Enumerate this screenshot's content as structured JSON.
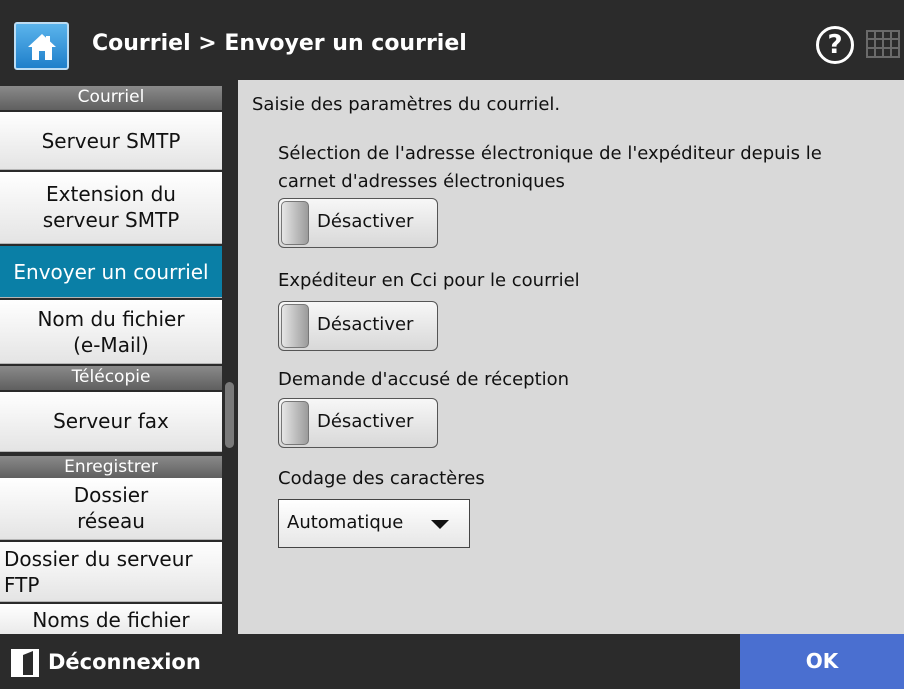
{
  "header": {
    "title": "Courriel > Envoyer un courriel",
    "help_label": "?"
  },
  "sidebar": {
    "items": [
      {
        "label": "Courriel",
        "type": "section"
      },
      {
        "label": "Serveur SMTP",
        "type": "item"
      },
      {
        "label": "Extension du serveur SMTP",
        "type": "item"
      },
      {
        "label": "Envoyer un courriel",
        "type": "item",
        "active": true
      },
      {
        "label": "Nom du fichier (e-Mail)",
        "type": "item"
      },
      {
        "label": "Télécopie",
        "type": "section"
      },
      {
        "label": "Serveur fax",
        "type": "item"
      },
      {
        "label": "Enregistrer",
        "type": "section"
      },
      {
        "label": "Dossier réseau",
        "type": "item"
      },
      {
        "label": "Dossier du serveur FTP",
        "type": "item"
      },
      {
        "label": "Noms de fichier",
        "type": "item"
      }
    ]
  },
  "main": {
    "intro": "Saisie des paramètres du courriel.",
    "settings": [
      {
        "label_line1": "Sélection de l'adresse électronique de l'expéditeur depuis le",
        "label_line2": "carnet d'adresses électroniques",
        "toggle": "Désactiver"
      },
      {
        "label_line1": "Expéditeur en Cci pour le courriel",
        "toggle": "Désactiver"
      },
      {
        "label_line1": "Demande d'accusé de réception",
        "toggle": "Désactiver"
      }
    ],
    "encoding": {
      "label": "Codage des caractères",
      "value": "Automatique"
    }
  },
  "footer": {
    "logout_label": "Déconnexion",
    "ok_label": "OK"
  },
  "colors": {
    "accent_active": "#0a7fa6",
    "ok_button": "#4a6fd0",
    "header_bg": "#2b2b2b"
  }
}
